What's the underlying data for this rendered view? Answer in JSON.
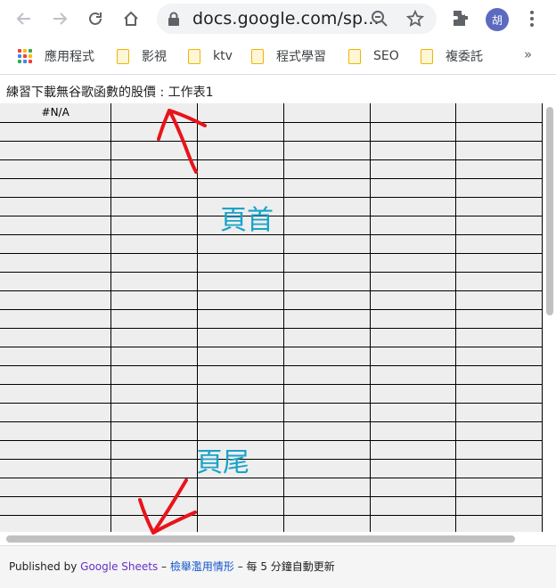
{
  "browser": {
    "url": "docs.google.com/sp...",
    "avatar_label": "胡",
    "bookmarks": [
      {
        "label": "應用程式",
        "icon": "apps-grid-icon"
      },
      {
        "label": "影視",
        "icon": "folder-icon"
      },
      {
        "label": "ktv",
        "icon": "folder-icon"
      },
      {
        "label": "程式學習",
        "icon": "folder-icon"
      },
      {
        "label": "SEO",
        "icon": "folder-icon"
      },
      {
        "label": "複委託",
        "icon": "folder-icon"
      }
    ],
    "more_label": "»"
  },
  "sheet": {
    "title": "練習下載無谷歌函數的股價 : 工作表1",
    "first_cell": "#N/A"
  },
  "annotations": {
    "header_label": "頁首",
    "footer_label": "頁尾",
    "arrow_color": "#e8141b",
    "text_color": "#19a3c8"
  },
  "footer": {
    "published_by": "Published by",
    "brand_link": "Google Sheets",
    "sep1": "–",
    "report_link": "檢舉濫用情形",
    "sep2": "–",
    "update_text": "每 5 分鐘自動更新"
  }
}
